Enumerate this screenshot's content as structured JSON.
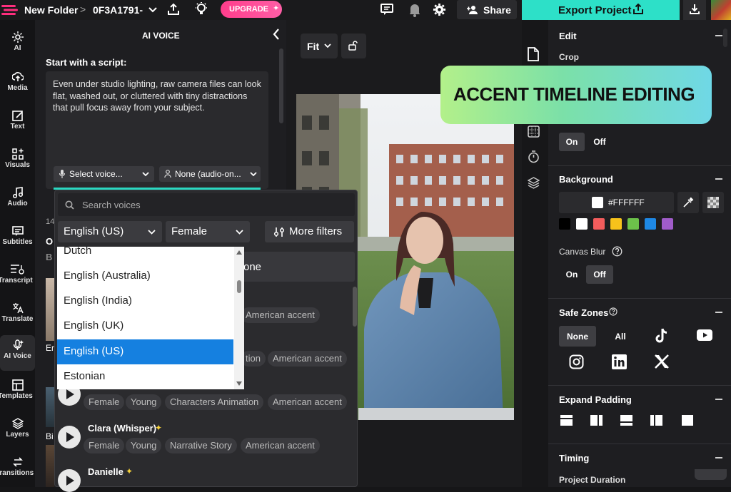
{
  "topbar": {
    "folder": "New Folder",
    "sep": ">",
    "project_id": "0F3A1791-",
    "upgrade": "UPGRADE",
    "share": "Share",
    "export": "Export Project"
  },
  "rail": [
    {
      "label": "AI",
      "icon": "sparkle-icon"
    },
    {
      "label": "Media",
      "icon": "upload-icon"
    },
    {
      "label": "Text",
      "icon": "text-edit-icon"
    },
    {
      "label": "Visuals",
      "icon": "grid-plus-icon"
    },
    {
      "label": "Audio",
      "icon": "music-note-icon"
    },
    {
      "label": "Subtitles",
      "icon": "subtitles-icon"
    },
    {
      "label": "Transcript",
      "icon": "transcript-icon"
    },
    {
      "label": "Translate",
      "icon": "translate-icon"
    },
    {
      "label": "AI Voice",
      "icon": "ai-voice-icon"
    },
    {
      "label": "Templates",
      "icon": "templates-icon"
    },
    {
      "label": "Layers",
      "icon": "layers-icon"
    },
    {
      "label": "Transitions",
      "icon": "transitions-icon"
    }
  ],
  "aivoice": {
    "title": "AI VOICE",
    "script_label": "Start with a script:",
    "script_text": "Even under studio lighting, raw camera files can look flat, washed out, or cluttered with tiny distractions that pull focus away from your subject.",
    "select_voice": "Select voice...",
    "audio_only": "None (audio-on...",
    "partial": [
      "14",
      "O",
      "B",
      "Er",
      "Bi"
    ]
  },
  "dropdown": {
    "search_placeholder": "Search voices",
    "language": "English (US)",
    "gender": "Female",
    "more_filters": "More filters",
    "none_row": "one",
    "languages": [
      "Dutch",
      "English (Australia)",
      "English (India)",
      "English (UK)",
      "English (US)",
      "Estonian"
    ],
    "selected_language": "English (US)",
    "voices": [
      {
        "name": "",
        "tags": [
          "American accent"
        ]
      },
      {
        "name": "",
        "tags": [
          "tion",
          "American accent"
        ]
      },
      {
        "name": "",
        "tags": [
          "Female",
          "Young",
          "Characters Animation",
          "American accent"
        ]
      },
      {
        "name": "Clara (Whisper)",
        "tags": [
          "Female",
          "Young",
          "Narrative Story",
          "American accent"
        ]
      },
      {
        "name": "Danielle",
        "tags": []
      }
    ]
  },
  "canvas": {
    "fit": "Fit"
  },
  "badge": {
    "text": "ACCENT TIMELINE EDITING"
  },
  "rightpanel": {
    "edit": "Edit",
    "crop": "Crop",
    "flip_on": "On",
    "flip_off": "Off",
    "background": "Background",
    "bg_hex": "#FFFFFF",
    "swatches": [
      "#000000",
      "#ffffff",
      "#f25c5c",
      "#f7c21b",
      "#6cc24a",
      "#1e88e5",
      "#a05cc9"
    ],
    "canvas_blur": "Canvas Blur",
    "blur_on": "On",
    "blur_off": "Off",
    "safe_zones": "Safe Zones",
    "sz_none": "None",
    "sz_all": "All",
    "expand_padding": "Expand Padding",
    "timing": "Timing",
    "project_duration": "Project Duration"
  }
}
